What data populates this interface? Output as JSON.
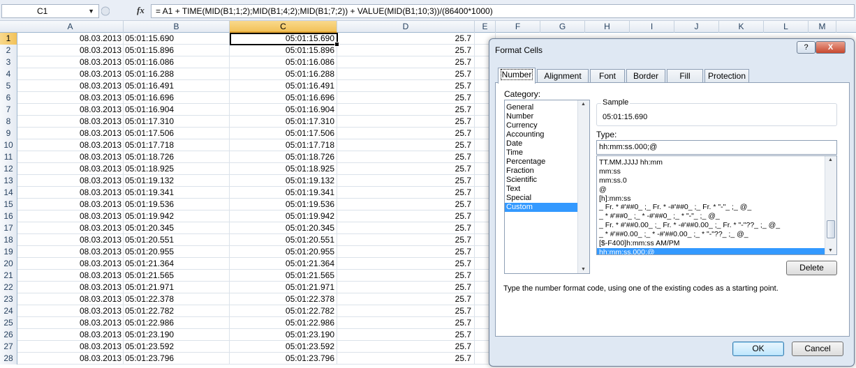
{
  "formula_bar": {
    "name_box": "C1",
    "fx": "fx",
    "formula": "= A1 + TIME(MID(B1;1;2);MID(B1;4;2);MID(B1;7;2)) + VALUE(MID(B1;10;3))/(86400*1000)"
  },
  "columns": [
    "A",
    "B",
    "C",
    "D",
    "E",
    "F",
    "G",
    "H",
    "I",
    "J",
    "K",
    "L",
    "M"
  ],
  "rows": [
    {
      "n": "1",
      "a": "08.03.2013",
      "b": "05:01:15.690",
      "c": "05:01:15.690",
      "d": "25.7"
    },
    {
      "n": "2",
      "a": "08.03.2013",
      "b": "05:01:15.896",
      "c": "05:01:15.896",
      "d": "25.7"
    },
    {
      "n": "3",
      "a": "08.03.2013",
      "b": "05:01:16.086",
      "c": "05:01:16.086",
      "d": "25.7"
    },
    {
      "n": "4",
      "a": "08.03.2013",
      "b": "05:01:16.288",
      "c": "05:01:16.288",
      "d": "25.7"
    },
    {
      "n": "5",
      "a": "08.03.2013",
      "b": "05:01:16.491",
      "c": "05:01:16.491",
      "d": "25.7"
    },
    {
      "n": "6",
      "a": "08.03.2013",
      "b": "05:01:16.696",
      "c": "05:01:16.696",
      "d": "25.7"
    },
    {
      "n": "7",
      "a": "08.03.2013",
      "b": "05:01:16.904",
      "c": "05:01:16.904",
      "d": "25.7"
    },
    {
      "n": "8",
      "a": "08.03.2013",
      "b": "05:01:17.310",
      "c": "05:01:17.310",
      "d": "25.7"
    },
    {
      "n": "9",
      "a": "08.03.2013",
      "b": "05:01:17.506",
      "c": "05:01:17.506",
      "d": "25.7"
    },
    {
      "n": "10",
      "a": "08.03.2013",
      "b": "05:01:17.718",
      "c": "05:01:17.718",
      "d": "25.7"
    },
    {
      "n": "11",
      "a": "08.03.2013",
      "b": "05:01:18.726",
      "c": "05:01:18.726",
      "d": "25.7"
    },
    {
      "n": "12",
      "a": "08.03.2013",
      "b": "05:01:18.925",
      "c": "05:01:18.925",
      "d": "25.7"
    },
    {
      "n": "13",
      "a": "08.03.2013",
      "b": "05:01:19.132",
      "c": "05:01:19.132",
      "d": "25.7"
    },
    {
      "n": "14",
      "a": "08.03.2013",
      "b": "05:01:19.341",
      "c": "05:01:19.341",
      "d": "25.7"
    },
    {
      "n": "15",
      "a": "08.03.2013",
      "b": "05:01:19.536",
      "c": "05:01:19.536",
      "d": "25.7"
    },
    {
      "n": "16",
      "a": "08.03.2013",
      "b": "05:01:19.942",
      "c": "05:01:19.942",
      "d": "25.7"
    },
    {
      "n": "17",
      "a": "08.03.2013",
      "b": "05:01:20.345",
      "c": "05:01:20.345",
      "d": "25.7"
    },
    {
      "n": "18",
      "a": "08.03.2013",
      "b": "05:01:20.551",
      "c": "05:01:20.551",
      "d": "25.7"
    },
    {
      "n": "19",
      "a": "08.03.2013",
      "b": "05:01:20.955",
      "c": "05:01:20.955",
      "d": "25.7"
    },
    {
      "n": "20",
      "a": "08.03.2013",
      "b": "05:01:21.364",
      "c": "05:01:21.364",
      "d": "25.7"
    },
    {
      "n": "21",
      "a": "08.03.2013",
      "b": "05:01:21.565",
      "c": "05:01:21.565",
      "d": "25.7"
    },
    {
      "n": "22",
      "a": "08.03.2013",
      "b": "05:01:21.971",
      "c": "05:01:21.971",
      "d": "25.7"
    },
    {
      "n": "23",
      "a": "08.03.2013",
      "b": "05:01:22.378",
      "c": "05:01:22.378",
      "d": "25.7"
    },
    {
      "n": "24",
      "a": "08.03.2013",
      "b": "05:01:22.782",
      "c": "05:01:22.782",
      "d": "25.7"
    },
    {
      "n": "25",
      "a": "08.03.2013",
      "b": "05:01:22.986",
      "c": "05:01:22.986",
      "d": "25.7"
    },
    {
      "n": "26",
      "a": "08.03.2013",
      "b": "05:01:23.190",
      "c": "05:01:23.190",
      "d": "25.7"
    },
    {
      "n": "27",
      "a": "08.03.2013",
      "b": "05:01:23.592",
      "c": "05:01:23.592",
      "d": "25.7"
    },
    {
      "n": "28",
      "a": "08.03.2013",
      "b": "05:01:23.796",
      "c": "05:01:23.796",
      "d": "25.7"
    }
  ],
  "dialog": {
    "title": "Format Cells",
    "help": "?",
    "close": "X",
    "tabs": [
      "Number",
      "Alignment",
      "Font",
      "Border",
      "Fill",
      "Protection"
    ],
    "category_label": "Category:",
    "categories": [
      "General",
      "Number",
      "Currency",
      "Accounting",
      "Date",
      "Time",
      "Percentage",
      "Fraction",
      "Scientific",
      "Text",
      "Special",
      "Custom"
    ],
    "sample_label": "Sample",
    "sample_value": "05:01:15.690",
    "type_label": "Type:",
    "type_value": "hh:mm:ss.000;@",
    "type_list": [
      "TT.MM.JJJJ hh:mm",
      "mm:ss",
      "mm:ss.0",
      "@",
      "[h]:mm:ss",
      "_ Fr. * #'##0_ ;_ Fr. * -#'##0_ ;_ Fr. * \"-\"_ ;_ @_",
      "_ * #'##0_ ;_ * -#'##0_ ;_ * \"-\"_ ;_ @_",
      "_ Fr. * #'##0.00_ ;_ Fr. * -#'##0.00_ ;_ Fr. * \"-\"??_ ;_ @_",
      "_ * #'##0.00_ ;_ * -#'##0.00_ ;_ * \"-\"??_ ;_ @_",
      "[$-F400]h:mm:ss AM/PM",
      "hh:mm:ss.000;@"
    ],
    "delete_label": "Delete",
    "hint": "Type the number format code, using one of the existing codes as a starting point.",
    "ok_label": "OK",
    "cancel_label": "Cancel"
  }
}
